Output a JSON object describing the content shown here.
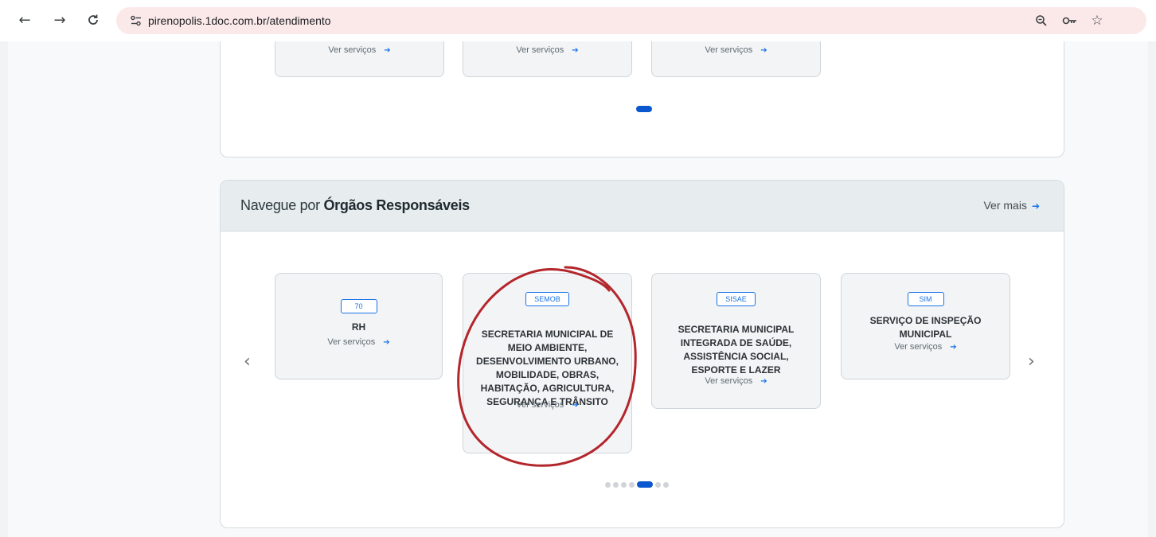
{
  "browser": {
    "url": "pirenopolis.1doc.com.br/atendimento",
    "back_icon": "arrow-left-icon",
    "forward_icon": "arrow-right-icon",
    "reload_icon": "reload-icon",
    "site_info_icon": "tune-icon",
    "zoom_icon": "zoom-icon",
    "key_icon": "key-icon",
    "star_icon": "star-icon"
  },
  "top_section": {
    "cards": [
      {
        "service_link": "Ver serviços"
      },
      {
        "service_link": "Ver serviços"
      },
      {
        "service_link": "Ver serviços"
      }
    ]
  },
  "orgaos_section": {
    "title_prefix": "Navegue por ",
    "title_bold": "Órgãos Responsáveis",
    "more_link": "Ver mais",
    "cards": [
      {
        "badge": "70",
        "name": "RH",
        "service_link": "Ver serviços"
      },
      {
        "badge": "SEMOB",
        "name": "SECRETARIA MUNICIPAL DE MEIO AMBIENTE, DESENVOLVIMENTO URBANO, MOBILIDADE, OBRAS, HABITAÇÃO, AGRICULTURA, SEGURANÇA E TRÂNSITO",
        "service_link": "Ver serviços"
      },
      {
        "badge": "SISAE",
        "name": "SECRETARIA MUNICIPAL INTEGRADA DE SAÚDE, ASSISTÊNCIA SOCIAL, ESPORTE E LAZER",
        "service_link": "Ver serviços"
      },
      {
        "badge": "SIM",
        "name": "SERVIÇO DE INSPEÇÃO MUNICIPAL",
        "service_link": "Ver serviços"
      }
    ],
    "pagination_active_index": 4,
    "pagination_total": 7
  },
  "colors": {
    "accent": "#1a73e8",
    "active_dot": "#0b57d0",
    "annotation": "#b3262c",
    "omnibox": "#fbe9ea"
  }
}
